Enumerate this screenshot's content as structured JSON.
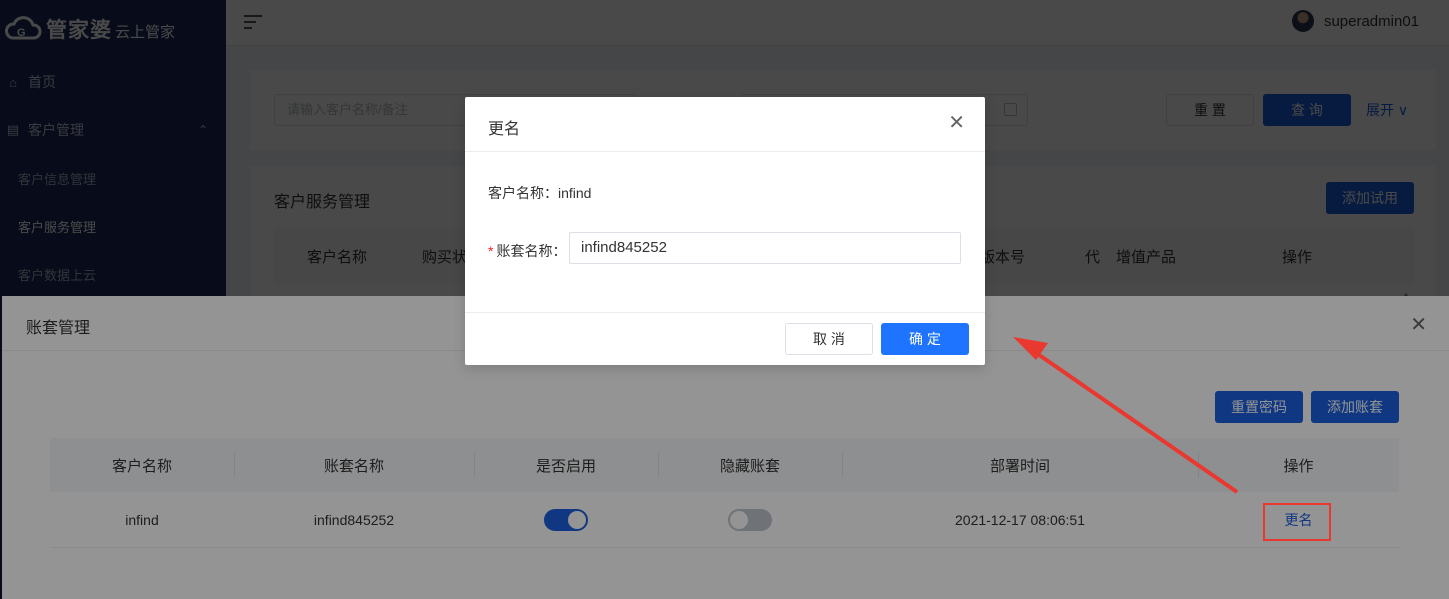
{
  "app": {
    "brand": "管家婆",
    "brand_sub": "云上管家",
    "user_name": "superadmin01"
  },
  "sidebar": {
    "items": [
      {
        "label": "首页"
      },
      {
        "label": "客户管理"
      }
    ],
    "sub_items": [
      {
        "label": "客户信息管理"
      },
      {
        "label": "客户服务管理"
      },
      {
        "label": "客户数据上云"
      }
    ]
  },
  "filter": {
    "search_placeholder": "请输入客户名称/备注",
    "reset_label": "重 置",
    "query_label": "查 询",
    "expand_label": "展开"
  },
  "main": {
    "title": "客户服务管理",
    "add_trial_label": "添加试用",
    "columns": [
      "客户名称",
      "购买状",
      "版本号",
      "代",
      "增值产品",
      "操作"
    ]
  },
  "account_panel": {
    "title": "账套管理",
    "reset_password_label": "重置密码",
    "add_account_label": "添加账套",
    "columns": [
      "客户名称",
      "账套名称",
      "是否启用",
      "隐藏账套",
      "部署时间",
      "操作"
    ],
    "rows": [
      {
        "customer": "infind",
        "account": "infind845252",
        "enabled": true,
        "hidden": false,
        "deploy_time": "2021-12-17 08:06:51",
        "action": "更名"
      }
    ]
  },
  "rename_dialog": {
    "title": "更名",
    "customer_line": "客户名称：infind",
    "account_label": "账套名称：",
    "required_mark": "*",
    "account_value": "infind845252",
    "cancel_label": "取 消",
    "ok_label": "确 定"
  },
  "colors": {
    "sidebar_bg": "#1f2d5c",
    "primary": "#1a5fe0",
    "annotation_red": "#e8382f"
  }
}
